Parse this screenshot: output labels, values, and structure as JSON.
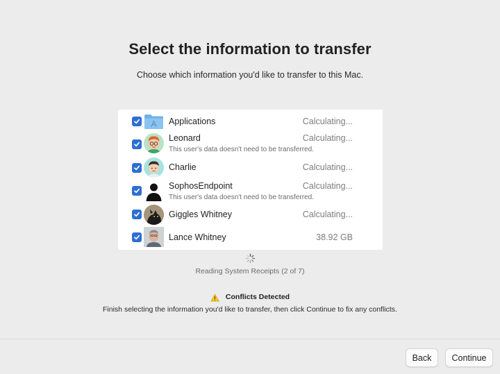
{
  "header": {
    "title": "Select the information to transfer",
    "subtitle": "Choose which information you'd like to transfer to this Mac."
  },
  "items": [
    {
      "name": "Applications",
      "status": "Calculating...",
      "note": "",
      "checked": true,
      "icon": "applications-folder-icon"
    },
    {
      "name": "Leonard",
      "status": "Calculating...",
      "note": "This user's data doesn't need to be transferred.",
      "checked": true,
      "icon": "memoji-avatar-icon"
    },
    {
      "name": "Charlie",
      "status": "Calculating...",
      "note": "",
      "checked": true,
      "icon": "memoji-avatar-icon"
    },
    {
      "name": "SophosEndpoint",
      "status": "Calculating...",
      "note": "This user's data doesn't need to be transferred.",
      "checked": true,
      "icon": "generic-user-silhouette-icon"
    },
    {
      "name": "Giggles Whitney",
      "status": "Calculating...",
      "note": "",
      "checked": true,
      "icon": "cat-photo-avatar-icon"
    },
    {
      "name": "Lance Whitney",
      "status": "38.92 GB",
      "note": "",
      "checked": true,
      "icon": "person-photo-avatar-icon"
    }
  ],
  "progress": {
    "status": "Reading System Receipts (2 of 7)"
  },
  "conflicts": {
    "title": "Conflicts Detected",
    "description": "Finish selecting the information you'd like to transfer, then click Continue to fix any conflicts.",
    "icon": "warning-triangle-icon"
  },
  "buttons": {
    "back": "Back",
    "continue": "Continue"
  },
  "colors": {
    "checkbox": "#2d6fd4",
    "background": "#ececec",
    "warning": "#f2c230"
  }
}
